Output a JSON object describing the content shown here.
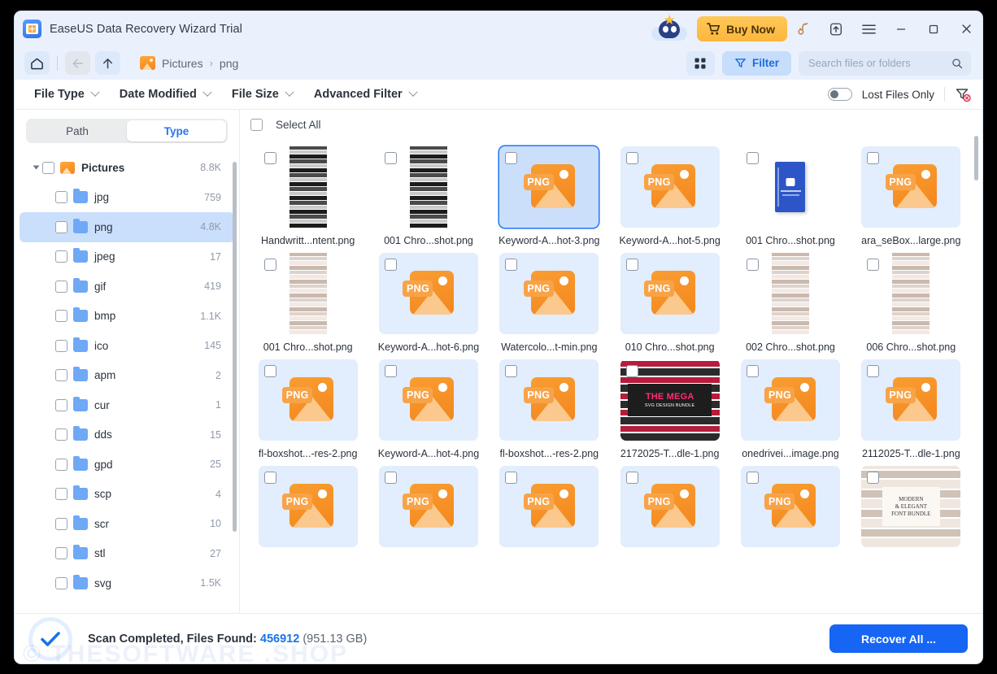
{
  "window": {
    "title": "EaseUS Data Recovery Wizard Trial",
    "buy_label": "Buy Now",
    "minimize_label": "—",
    "maximize_label": "□",
    "close_label": "✕"
  },
  "navbar": {
    "breadcrumb": [
      {
        "label": "Pictures",
        "icon": "pictures-folder-icon"
      },
      {
        "label": "png",
        "icon": ""
      }
    ],
    "separator": "›",
    "filter_label": "Filter",
    "search_placeholder": "Search files or folders",
    "search_value": ""
  },
  "filterbar": {
    "items": [
      {
        "label": "File Type"
      },
      {
        "label": "Date Modified"
      },
      {
        "label": "File Size"
      },
      {
        "label": "Advanced Filter"
      }
    ],
    "lost_files_label": "Lost Files Only",
    "lost_files_on": false
  },
  "sidebar": {
    "tabs": [
      {
        "label": "Path",
        "active": false
      },
      {
        "label": "Type",
        "active": true
      }
    ],
    "tree": [
      {
        "label": "Pictures",
        "count": "8.8K",
        "root": true,
        "icon": "pictures-folder-icon",
        "selected": false
      },
      {
        "label": "jpg",
        "count": "759",
        "root": false,
        "icon": "folder-icon",
        "selected": false
      },
      {
        "label": "png",
        "count": "4.8K",
        "root": false,
        "icon": "folder-icon",
        "selected": true
      },
      {
        "label": "jpeg",
        "count": "17",
        "root": false,
        "icon": "folder-icon",
        "selected": false
      },
      {
        "label": "gif",
        "count": "419",
        "root": false,
        "icon": "folder-icon",
        "selected": false
      },
      {
        "label": "bmp",
        "count": "1.1K",
        "root": false,
        "icon": "folder-icon",
        "selected": false
      },
      {
        "label": "ico",
        "count": "145",
        "root": false,
        "icon": "folder-icon",
        "selected": false
      },
      {
        "label": "apm",
        "count": "2",
        "root": false,
        "icon": "folder-icon",
        "selected": false
      },
      {
        "label": "cur",
        "count": "1",
        "root": false,
        "icon": "folder-icon",
        "selected": false
      },
      {
        "label": "dds",
        "count": "15",
        "root": false,
        "icon": "folder-icon",
        "selected": false
      },
      {
        "label": "gpd",
        "count": "25",
        "root": false,
        "icon": "folder-icon",
        "selected": false
      },
      {
        "label": "scp",
        "count": "4",
        "root": false,
        "icon": "folder-icon",
        "selected": false
      },
      {
        "label": "scr",
        "count": "10",
        "root": false,
        "icon": "folder-icon",
        "selected": false
      },
      {
        "label": "stl",
        "count": "27",
        "root": false,
        "icon": "folder-icon",
        "selected": false
      },
      {
        "label": "svg",
        "count": "1.5K",
        "root": false,
        "icon": "folder-icon",
        "selected": false
      }
    ]
  },
  "files": {
    "select_all_label": "Select All",
    "items": [
      {
        "name": "Handwritt...ntent.png",
        "thumb": "collage-dark",
        "selected": false
      },
      {
        "name": "001 Chro...shot.png",
        "thumb": "collage-dark",
        "selected": false
      },
      {
        "name": "Keyword-A...hot-3.png",
        "thumb": "png-icon",
        "selected": true
      },
      {
        "name": "Keyword-A...hot-5.png",
        "thumb": "png-icon",
        "selected": false
      },
      {
        "name": "001 Chro...shot.png",
        "thumb": "booklet",
        "selected": false
      },
      {
        "name": "ara_seBox...large.png",
        "thumb": "png-icon",
        "selected": false
      },
      {
        "name": "001 Chro...shot.png",
        "thumb": "collage-light",
        "selected": false
      },
      {
        "name": "Keyword-A...hot-6.png",
        "thumb": "png-icon",
        "selected": false
      },
      {
        "name": "Watercolo...t-min.png",
        "thumb": "png-icon",
        "selected": false
      },
      {
        "name": "010 Chro...shot.png",
        "thumb": "png-icon",
        "selected": false
      },
      {
        "name": "002 Chro...shot.png",
        "thumb": "collage-light",
        "selected": false
      },
      {
        "name": "006 Chro...shot.png",
        "thumb": "collage-light",
        "selected": false
      },
      {
        "name": "fl-boxshot...-res-2.png",
        "thumb": "png-icon",
        "selected": false
      },
      {
        "name": "Keyword-A...hot-4.png",
        "thumb": "png-icon",
        "selected": false
      },
      {
        "name": "fl-boxshot...-res-2.png",
        "thumb": "png-icon",
        "selected": false
      },
      {
        "name": "2172025-T...dle-1.png",
        "thumb": "mega-bundle",
        "selected": false
      },
      {
        "name": "onedrivei...image.png",
        "thumb": "png-icon",
        "selected": false
      },
      {
        "name": "2112025-T...dle-1.png",
        "thumb": "png-icon",
        "selected": false
      },
      {
        "name": "",
        "thumb": "png-icon",
        "selected": false
      },
      {
        "name": "",
        "thumb": "png-icon",
        "selected": false
      },
      {
        "name": "",
        "thumb": "png-icon",
        "selected": false
      },
      {
        "name": "",
        "thumb": "png-icon",
        "selected": false
      },
      {
        "name": "",
        "thumb": "png-icon",
        "selected": false
      },
      {
        "name": "",
        "thumb": "font-bundle",
        "selected": false
      }
    ],
    "png_badge_text": "PNG",
    "mega_line1": "THE MEGA",
    "mega_line2": "SVG DESIGN BUNDLE",
    "fontb_line1": "MODERN",
    "fontb_line2": "& ELEGANT",
    "fontb_line3": "FONT BUNDLE"
  },
  "status": {
    "message": "Scan Completed, Files Found:",
    "files_found": "456912",
    "size": "(951.13 GB)",
    "recover_label": "Recover All ...",
    "watermark": "© THESOFTWARE .SHOP"
  },
  "colors": {
    "accent_blue": "#1665f5",
    "link_blue": "#1a73e8",
    "buy_orange": "#fbb63d",
    "titlebar_bg": "#eaf1fd",
    "selection_blue": "#cadffc"
  }
}
